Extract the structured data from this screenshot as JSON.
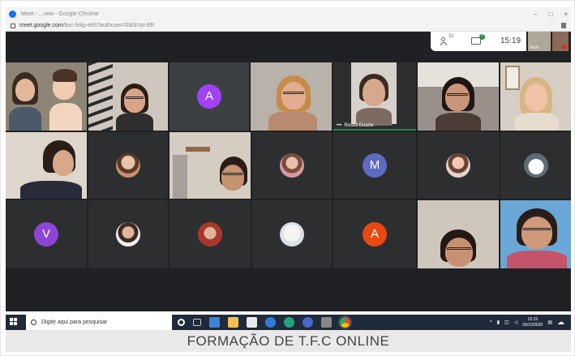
{
  "browser": {
    "tab_title": "Meet - ...vew - Google Chrome",
    "minimize": "–",
    "maximize": "□",
    "close": "×",
    "url_host": "meet.google.com",
    "url_path": "/bxc-fxkp-ekh?authuser=0&hl=pt-BR"
  },
  "meet": {
    "people_count": "31",
    "chat_count": "7",
    "time": "15:19",
    "self_label": "Você",
    "speaker_name": "Roseli Duarte",
    "avatars": {
      "a1": "A",
      "m": "M",
      "v": "V",
      "a2": "A"
    },
    "colors": {
      "avatar_a1": "#a142f4",
      "avatar_m": "#5c6bc0",
      "avatar_v": "#8e44d6",
      "avatar_a2": "#e8490f",
      "speaking": "#1e8e3e",
      "background": "#202124"
    }
  },
  "taskbar": {
    "search_placeholder": "Digite aqui para pesquisar",
    "tray_time": "15:19",
    "tray_date": "06/10/2020"
  },
  "caption": "FORMAÇÃO DE T.F.C ONLINE"
}
